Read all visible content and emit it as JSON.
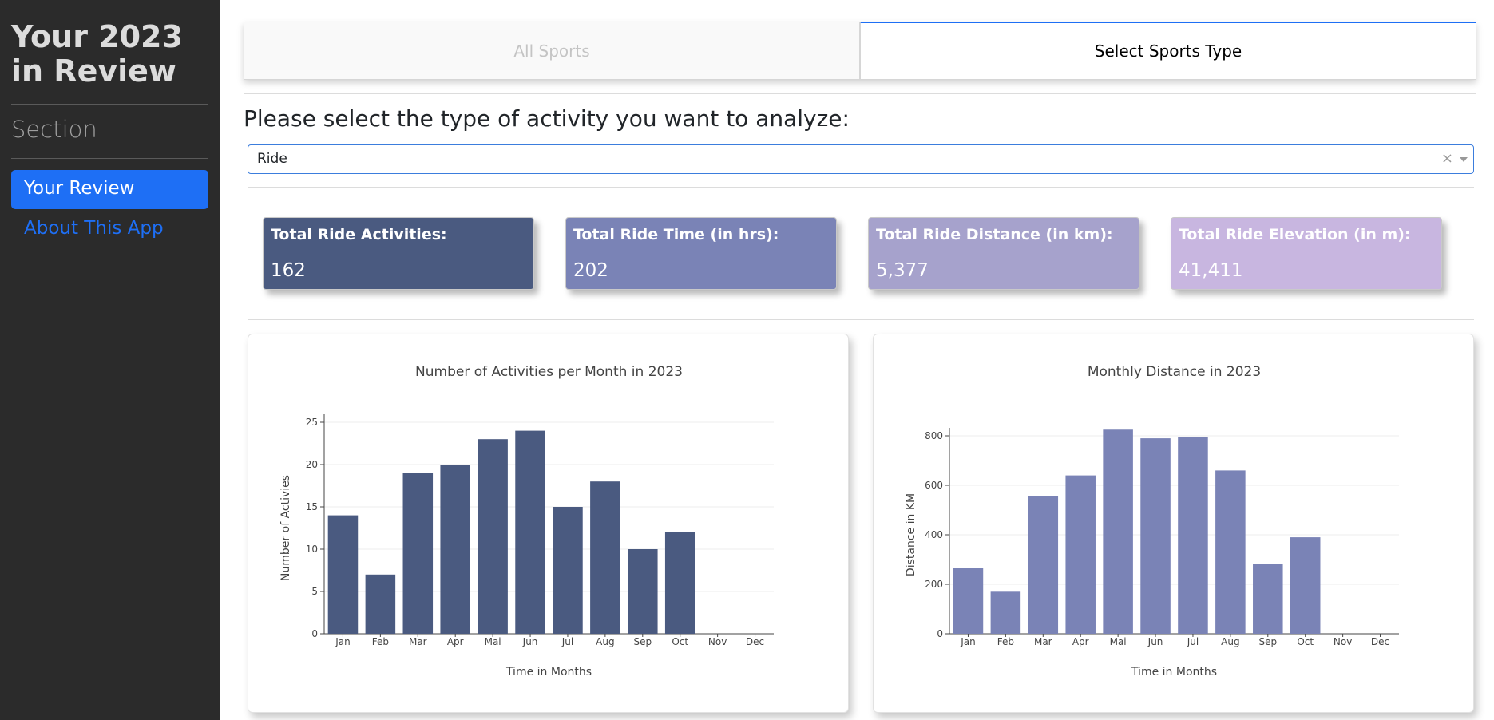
{
  "sidebar": {
    "title": "Your 2023 in Review",
    "section_label": "Section",
    "items": [
      {
        "label": "Your Review",
        "active": true
      },
      {
        "label": "About This App",
        "active": false
      }
    ]
  },
  "tabs": [
    {
      "label": "All Sports",
      "active": false
    },
    {
      "label": "Select Sports Type",
      "active": true
    }
  ],
  "prompt": "Please select the type of activity you want to analyze:",
  "activity_select": {
    "value": "Ride",
    "clear_icon": "×"
  },
  "cards": [
    {
      "title": "Total Ride Activities:",
      "value": "162",
      "color": "#4a5a80"
    },
    {
      "title": "Total Ride Time (in hrs):",
      "value": "202",
      "color": "#7a83b6"
    },
    {
      "title": "Total Ride Distance (in km):",
      "value": "5,377",
      "color": "#a6a2cc"
    },
    {
      "title": "Total Ride Elevation (in m):",
      "value": "41,411",
      "color": "#c8b6e0"
    }
  ],
  "chart_data": [
    {
      "type": "bar",
      "title": "Number of Activities per Month in 2023",
      "xlabel": "Time in Months",
      "ylabel": "Number of Activies",
      "categories": [
        "Jan",
        "Feb",
        "Mar",
        "Apr",
        "Mai",
        "Jun",
        "Jul",
        "Aug",
        "Sep",
        "Oct",
        "Nov",
        "Dec"
      ],
      "values": [
        14,
        7,
        19,
        20,
        23,
        24,
        15,
        18,
        10,
        12,
        0,
        0
      ],
      "ylim": [
        0,
        25
      ],
      "yticks": [
        0,
        5,
        10,
        15,
        20,
        25
      ],
      "color": "#4a5a80",
      "grid": true
    },
    {
      "type": "bar",
      "title": "Monthly Distance in 2023",
      "xlabel": "Time in Months",
      "ylabel": "Distance in KM",
      "categories": [
        "Jan",
        "Feb",
        "Mar",
        "Apr",
        "Mai",
        "Jun",
        "Jul",
        "Aug",
        "Sep",
        "Oct",
        "Nov",
        "Dec"
      ],
      "values": [
        265,
        170,
        555,
        640,
        825,
        790,
        795,
        660,
        282,
        390,
        0,
        0
      ],
      "ylim": [
        0,
        800
      ],
      "yticks": [
        0,
        200,
        400,
        600,
        800
      ],
      "color": "#7a83b6",
      "grid": true
    }
  ]
}
